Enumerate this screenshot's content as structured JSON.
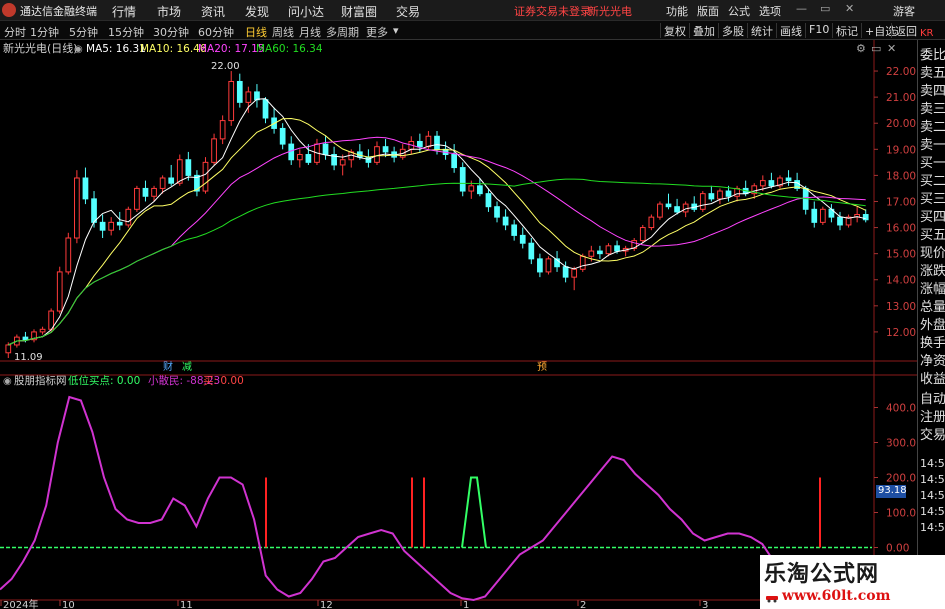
{
  "titlebar": {
    "app_name": "通达信金融终端",
    "menus": [
      "行情",
      "市场",
      "资讯",
      "发现",
      "问小达",
      "财富圈",
      "交易"
    ],
    "warning": "证券交易未登录",
    "stock_name": "新光光电",
    "right_menus": [
      "功能",
      "版面",
      "公式",
      "选项"
    ],
    "guest": "游客"
  },
  "periodbar": {
    "tabs": [
      "分时",
      "1分钟",
      "5分钟",
      "15分钟",
      "30分钟",
      "60分钟",
      "日线",
      "周线",
      "月线",
      "多周期",
      "更多"
    ],
    "active_tab": "日线",
    "right_buttons": [
      "复权",
      "叠加",
      "多股",
      "统计",
      "画线",
      "F10",
      "标记",
      "+自选",
      "返回"
    ]
  },
  "main_header": {
    "title": "新光光电(日线)",
    "ma5": "MA5: 16.31",
    "ma10": "MA10: 16.46",
    "ma20": "MA20: 17.15",
    "ma60": "MA60: 16.34",
    "high_label": "22.00",
    "low_label": "11.09",
    "event_labels": [
      "财",
      "减",
      "预"
    ]
  },
  "sub_header": {
    "title": "股朋指标网",
    "low_buy": "低位买点: 0.00",
    "small_investor": "小散民: -88.23",
    "buy": "买: 0.00"
  },
  "colors": {
    "up": "#ff3b3b",
    "down": "#54ffff",
    "ma5": "#ffffff",
    "ma10": "#ffff66",
    "ma20": "#ff44ff",
    "ma60": "#22dd22",
    "indicator": "#d033d0"
  },
  "sidebar": {
    "items": [
      "委比",
      "卖五",
      "卖四",
      "卖三",
      "卖二",
      "卖一",
      "买一",
      "买二",
      "买三",
      "买四",
      "买五",
      "现价",
      "涨跌",
      "涨幅",
      "总量",
      "外盘",
      "换手",
      "净资",
      "收益"
    ],
    "top": "KR",
    "sub_items": [
      "自动",
      "注册",
      "交易"
    ],
    "times": [
      "14:54",
      "14:54",
      "14:54",
      "14:55",
      "14:55"
    ]
  },
  "badge": "93.18",
  "watermark": {
    "line1": "乐淘公式网",
    "line2": "www.60lt.com"
  },
  "chart_data": [
    {
      "type": "candlestick",
      "title": "新光光电(日线)",
      "y_ticks": [
        12.0,
        13.0,
        14.0,
        15.0,
        16.0,
        17.0,
        18.0,
        19.0,
        20.0,
        21.0,
        22.0
      ],
      "ylim": [
        11.0,
        22.5
      ],
      "x_labels": [
        "2024年",
        "10",
        "11",
        "12",
        "1",
        "2",
        "3"
      ],
      "candles": [
        [
          11.2,
          11.6,
          11.0,
          11.5
        ],
        [
          11.5,
          11.9,
          11.4,
          11.8
        ],
        [
          11.8,
          12.0,
          11.6,
          11.7
        ],
        [
          11.7,
          12.1,
          11.6,
          12.0
        ],
        [
          12.0,
          12.2,
          11.9,
          12.1
        ],
        [
          12.1,
          12.9,
          12.0,
          12.8
        ],
        [
          12.8,
          14.5,
          12.7,
          14.3
        ],
        [
          14.3,
          15.8,
          14.2,
          15.6
        ],
        [
          15.6,
          18.2,
          15.4,
          17.9
        ],
        [
          17.9,
          18.3,
          16.9,
          17.1
        ],
        [
          17.1,
          17.4,
          16.0,
          16.2
        ],
        [
          16.2,
          16.5,
          15.6,
          15.9
        ],
        [
          15.9,
          16.4,
          15.7,
          16.2
        ],
        [
          16.2,
          16.6,
          15.9,
          16.1
        ],
        [
          16.1,
          16.8,
          16.0,
          16.7
        ],
        [
          16.7,
          17.6,
          16.6,
          17.5
        ],
        [
          17.5,
          17.8,
          17.0,
          17.2
        ],
        [
          17.2,
          17.6,
          17.0,
          17.5
        ],
        [
          17.5,
          18.0,
          17.3,
          17.9
        ],
        [
          17.9,
          18.4,
          17.6,
          17.7
        ],
        [
          17.7,
          18.8,
          17.6,
          18.6
        ],
        [
          18.6,
          18.9,
          17.8,
          18.0
        ],
        [
          18.0,
          18.2,
          17.2,
          17.4
        ],
        [
          17.4,
          18.7,
          17.3,
          18.5
        ],
        [
          18.5,
          19.6,
          18.4,
          19.4
        ],
        [
          19.4,
          20.3,
          19.2,
          20.1
        ],
        [
          20.1,
          22.0,
          19.9,
          21.6
        ],
        [
          21.6,
          21.9,
          20.6,
          20.8
        ],
        [
          20.8,
          21.4,
          20.4,
          21.2
        ],
        [
          21.2,
          21.5,
          20.6,
          20.9
        ],
        [
          20.9,
          21.0,
          20.0,
          20.2
        ],
        [
          20.2,
          20.6,
          19.6,
          19.8
        ],
        [
          19.8,
          20.0,
          19.0,
          19.2
        ],
        [
          19.2,
          19.5,
          18.4,
          18.6
        ],
        [
          18.6,
          19.0,
          18.3,
          18.8
        ],
        [
          18.8,
          19.2,
          18.4,
          18.5
        ],
        [
          18.5,
          19.4,
          18.4,
          19.2
        ],
        [
          19.2,
          19.5,
          18.6,
          18.8
        ],
        [
          18.8,
          19.1,
          18.2,
          18.4
        ],
        [
          18.4,
          18.8,
          18.0,
          18.6
        ],
        [
          18.6,
          19.0,
          18.3,
          18.9
        ],
        [
          18.9,
          19.2,
          18.6,
          18.7
        ],
        [
          18.7,
          19.0,
          18.3,
          18.5
        ],
        [
          18.5,
          19.3,
          18.4,
          19.1
        ],
        [
          19.1,
          19.4,
          18.7,
          18.9
        ],
        [
          18.9,
          19.1,
          18.5,
          18.7
        ],
        [
          18.7,
          19.2,
          18.6,
          19.0
        ],
        [
          19.0,
          19.5,
          18.8,
          19.3
        ],
        [
          19.3,
          19.6,
          18.9,
          19.1
        ],
        [
          19.1,
          19.7,
          19.0,
          19.5
        ],
        [
          19.5,
          19.7,
          18.8,
          19.0
        ],
        [
          19.0,
          19.3,
          18.6,
          18.8
        ],
        [
          18.8,
          19.2,
          18.1,
          18.3
        ],
        [
          18.3,
          18.5,
          17.2,
          17.4
        ],
        [
          17.4,
          17.8,
          17.1,
          17.6
        ],
        [
          17.6,
          17.9,
          17.2,
          17.3
        ],
        [
          17.3,
          17.5,
          16.6,
          16.8
        ],
        [
          16.8,
          17.0,
          16.2,
          16.4
        ],
        [
          16.4,
          16.7,
          15.9,
          16.1
        ],
        [
          16.1,
          16.3,
          15.5,
          15.7
        ],
        [
          15.7,
          16.0,
          15.2,
          15.4
        ],
        [
          15.4,
          15.6,
          14.6,
          14.8
        ],
        [
          14.8,
          15.0,
          14.1,
          14.3
        ],
        [
          14.3,
          14.9,
          14.2,
          14.8
        ],
        [
          14.8,
          15.1,
          14.3,
          14.5
        ],
        [
          14.5,
          14.7,
          13.9,
          14.1
        ],
        [
          14.1,
          14.5,
          13.6,
          14.4
        ],
        [
          14.4,
          15.0,
          14.3,
          14.9
        ],
        [
          14.9,
          15.3,
          14.7,
          15.1
        ],
        [
          15.1,
          15.3,
          14.8,
          15.0
        ],
        [
          15.0,
          15.4,
          14.9,
          15.3
        ],
        [
          15.3,
          15.5,
          15.0,
          15.1
        ],
        [
          15.1,
          15.3,
          14.9,
          15.2
        ],
        [
          15.2,
          15.6,
          15.1,
          15.5
        ],
        [
          15.5,
          16.1,
          15.4,
          16.0
        ],
        [
          16.0,
          16.5,
          15.9,
          16.4
        ],
        [
          16.4,
          17.0,
          16.3,
          16.9
        ],
        [
          16.9,
          17.3,
          16.7,
          16.8
        ],
        [
          16.8,
          17.1,
          16.5,
          16.6
        ],
        [
          16.6,
          17.0,
          16.4,
          16.9
        ],
        [
          16.9,
          17.2,
          16.6,
          16.7
        ],
        [
          16.7,
          17.4,
          16.6,
          17.3
        ],
        [
          17.3,
          17.6,
          17.0,
          17.1
        ],
        [
          17.1,
          17.5,
          16.9,
          17.4
        ],
        [
          17.4,
          17.6,
          17.0,
          17.2
        ],
        [
          17.2,
          17.6,
          17.0,
          17.5
        ],
        [
          17.5,
          17.8,
          17.2,
          17.3
        ],
        [
          17.3,
          17.7,
          17.1,
          17.6
        ],
        [
          17.6,
          18.0,
          17.4,
          17.8
        ],
        [
          17.8,
          18.1,
          17.5,
          17.6
        ],
        [
          17.6,
          18.0,
          17.5,
          17.9
        ],
        [
          17.9,
          18.2,
          17.6,
          17.8
        ],
        [
          17.8,
          18.1,
          17.4,
          17.5
        ],
        [
          17.5,
          17.6,
          16.5,
          16.7
        ],
        [
          16.7,
          17.0,
          16.0,
          16.2
        ],
        [
          16.2,
          16.8,
          16.1,
          16.7
        ],
        [
          16.7,
          16.9,
          16.2,
          16.4
        ],
        [
          16.4,
          16.6,
          15.9,
          16.1
        ],
        [
          16.1,
          16.5,
          16.0,
          16.4
        ],
        [
          16.4,
          16.8,
          16.2,
          16.5
        ],
        [
          16.5,
          16.7,
          16.2,
          16.3
        ]
      ]
    },
    {
      "type": "line",
      "title": "股朋指标网",
      "y_ticks": [
        0.0,
        100.0,
        200.0,
        300.0,
        400.0
      ],
      "ylim": [
        -150,
        450
      ],
      "series": [
        {
          "name": "小散民",
          "values": [
            -120,
            -90,
            -40,
            20,
            120,
            300,
            430,
            420,
            330,
            200,
            110,
            80,
            70,
            70,
            80,
            140,
            120,
            60,
            140,
            200,
            200,
            180,
            80,
            -80,
            -120,
            -140,
            -130,
            -90,
            -40,
            -30,
            0,
            30,
            40,
            50,
            40,
            -10,
            -40,
            -70,
            -100,
            -130,
            -145,
            -150,
            -140,
            -100,
            -60,
            -20,
            0,
            20,
            60,
            100,
            140,
            180,
            220,
            260,
            250,
            210,
            180,
            150,
            110,
            80,
            40,
            20,
            30,
            40,
            40,
            30,
            10,
            -40,
            -100,
            -160
          ]
        },
        {
          "name": "低位买点",
          "values": []
        },
        {
          "name": "买",
          "values": []
        }
      ]
    }
  ]
}
